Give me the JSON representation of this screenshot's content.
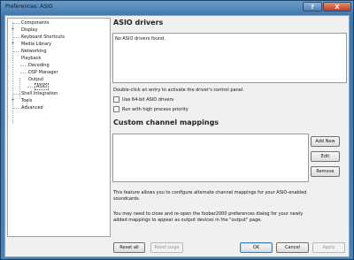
{
  "window": {
    "title": "Preferences: ASIO",
    "help_label": "?",
    "close_label": "X"
  },
  "tree": {
    "items": [
      {
        "label": "Components",
        "level": 0
      },
      {
        "label": "Display",
        "level": 0,
        "expander": "+"
      },
      {
        "label": "Keyboard Shortcuts",
        "level": 0
      },
      {
        "label": "Media Library",
        "level": 0,
        "expander": "+"
      },
      {
        "label": "Networking",
        "level": 0
      },
      {
        "label": "Playback",
        "level": 0,
        "expander": "-"
      },
      {
        "label": "Decoding",
        "level": 1
      },
      {
        "label": "DSP Manager",
        "level": 1
      },
      {
        "label": "Output",
        "level": 1,
        "expander": "-"
      },
      {
        "label": "ASIO",
        "level": 2,
        "selected": true
      },
      {
        "label": "Shell Integration",
        "level": 0
      },
      {
        "label": "Tools",
        "level": 0,
        "expander": "+"
      },
      {
        "label": "Advanced",
        "level": 0
      }
    ]
  },
  "asio": {
    "heading": "ASIO drivers",
    "list_text": "No ASIO drivers found.",
    "hint": "Double-click an entry to activate the driver's control panel.",
    "checkbox_64bit": "Use 64-bit ASIO drivers",
    "checkbox_priority": "Run with high process priority"
  },
  "mappings": {
    "heading": "Custom channel mappings",
    "add_label": "Add New",
    "edit_label": "Edit",
    "remove_label": "Remove",
    "desc1_line1": "This feature allows you to configure alternate channel mappings for your ASIO-enabled",
    "desc1_line2": "soundcards.",
    "desc2_line1": "You may need to close and re-open the foobar2000 preferences dialog for your newly",
    "desc2_line2": "added mappings to appear as output devices in the \"output\" page."
  },
  "footer": {
    "reset_all": "Reset all",
    "reset_page": "Reset page",
    "ok": "OK",
    "cancel": "Cancel",
    "apply": "Apply"
  }
}
